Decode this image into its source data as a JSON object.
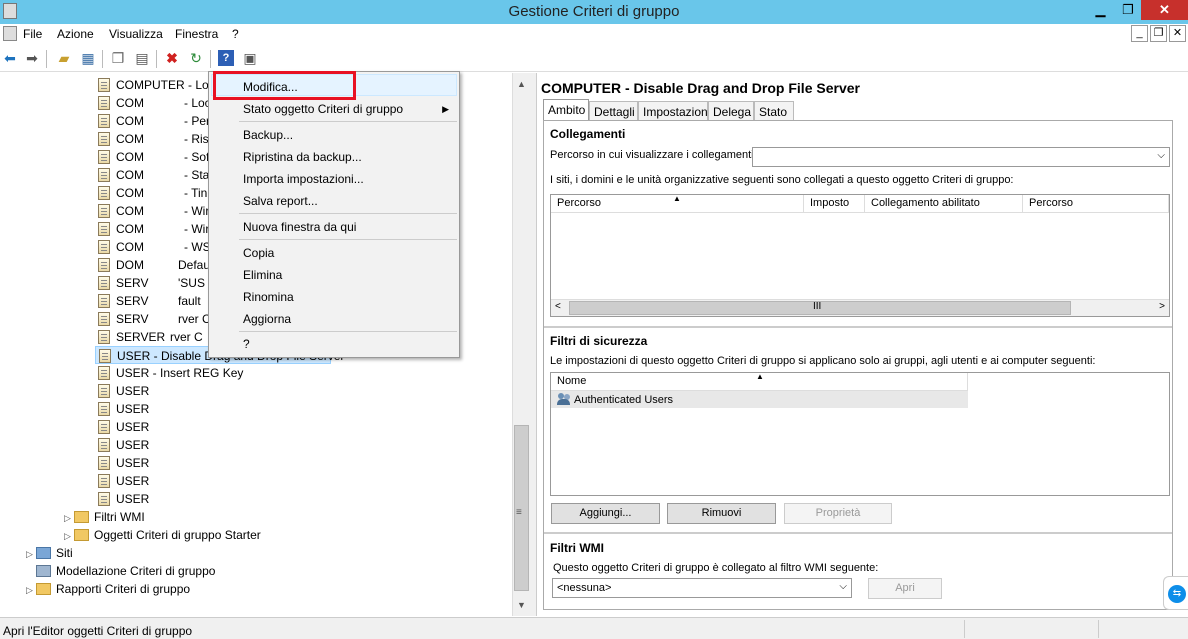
{
  "window": {
    "title": "Gestione Criteri di gruppo",
    "min": "▁",
    "max": "❐",
    "close": "✕"
  },
  "menu": [
    "File",
    "Azione",
    "Visualizza",
    "Finestra",
    "?"
  ],
  "mdi": {
    "min": "_",
    "restore": "❐",
    "close": "✕"
  },
  "toolbar_icons": [
    "back-icon",
    "forward-icon",
    "up-folder-icon",
    "show-hide-tree-icon",
    "copy-icon",
    "paste-icon",
    "delete-icon",
    "refresh-icon",
    "help-icon",
    "properties-icon"
  ],
  "tree": {
    "items": [
      {
        "label": "COMPUTER - Loc",
        "suffix": ""
      },
      {
        "label": "COM",
        "suffix": "- Loc"
      },
      {
        "label": "COM",
        "suffix": "- Per"
      },
      {
        "label": "COM",
        "suffix": "- Ris"
      },
      {
        "label": "COM",
        "suffix": "- Sof"
      },
      {
        "label": "COM",
        "suffix": "- Sta"
      },
      {
        "label": "COM",
        "suffix": "- Tin"
      },
      {
        "label": "COM",
        "suffix": "- Wir"
      },
      {
        "label": "COM",
        "suffix": "- Wir"
      },
      {
        "label": "COM",
        "suffix": "- WS"
      },
      {
        "label": "DOM",
        "suffix": "Defau"
      },
      {
        "label": "SERV",
        "suffix": "'SUS S"
      },
      {
        "label": "SERV",
        "suffix": "fault"
      },
      {
        "label": "SERV",
        "suffix": "rver C"
      },
      {
        "label": "SERVER",
        "suffix": "rver C"
      },
      {
        "label": "USER - Disable Drag and Drop File Server",
        "suffix": ""
      },
      {
        "label": "USER - Insert REG Key",
        "suffix": ""
      },
      {
        "label": "USER",
        "suffix": ""
      },
      {
        "label": "USER",
        "suffix": ""
      },
      {
        "label": "USER",
        "suffix": ""
      },
      {
        "label": "USER",
        "suffix": ""
      },
      {
        "label": "USER",
        "suffix": ""
      },
      {
        "label": "USER",
        "suffix": ""
      },
      {
        "label": "USER",
        "suffix": ""
      }
    ],
    "wmi": "Filtri WMI",
    "starter": "Oggetti Criteri di gruppo Starter",
    "siti": "Siti",
    "modellazione": "Modellazione Criteri di gruppo",
    "rapporti": "Rapporti Criteri di gruppo"
  },
  "context_menu": {
    "items": [
      "Modifica...",
      "Stato oggetto Criteri di gruppo",
      "Backup...",
      "Ripristina da backup...",
      "Importa impostazioni...",
      "Salva report...",
      "Nuova finestra da qui",
      "Copia",
      "Elimina",
      "Rinomina",
      "Aggiorna",
      "?"
    ],
    "submenu_arrow": "▶"
  },
  "details": {
    "title": "COMPUTER - Disable Drag and Drop File Server",
    "tabs": [
      "Ambito",
      "Dettagli",
      "Impostazioni",
      "Delega",
      "Stato"
    ],
    "collegamenti": {
      "header": "Collegamenti",
      "path_label": "Percorso in cui visualizzare i collegamenti:",
      "path_value": "",
      "desc": "I siti, i domini e le unità organizzative seguenti sono collegati a questo oggetto Criteri di gruppo:",
      "columns": [
        "Percorso",
        "Imposto",
        "Collegamento abilitato",
        "Percorso"
      ]
    },
    "filtri": {
      "header": "Filtri di sicurezza",
      "desc": "Le impostazioni di questo oggetto Criteri di gruppo si applicano solo ai gruppi, agli utenti e ai computer seguenti:",
      "column": "Nome",
      "rows": [
        "Authenticated Users"
      ],
      "buttons": {
        "add": "Aggiungi...",
        "remove": "Rimuovi",
        "props": "Proprietà"
      }
    },
    "wmi": {
      "header": "Filtri WMI",
      "desc": "Questo oggetto Criteri di gruppo è collegato al filtro WMI seguente:",
      "value": "<nessuna>",
      "open": "Apri"
    }
  },
  "status": {
    "text": "Apri l'Editor oggetti Criteri di gruppo"
  }
}
